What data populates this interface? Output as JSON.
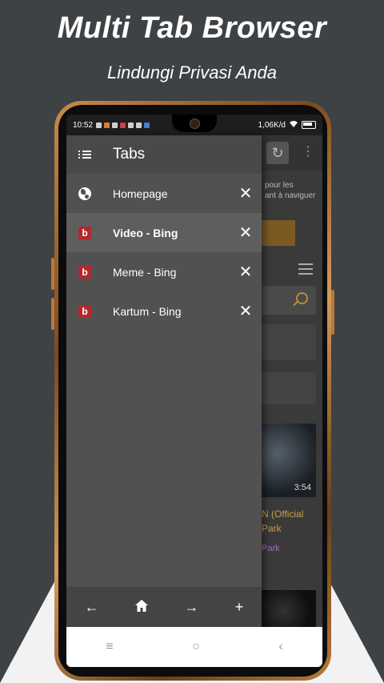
{
  "promo": {
    "headline": "Multi Tab Browser",
    "subline": "Lindungi Privasi Anda"
  },
  "status_bar": {
    "time": "10:52",
    "network_speed": "1,06K/d",
    "battery_icon": "battery-icon"
  },
  "drawer": {
    "title": "Tabs",
    "menu_icon": "list-icon",
    "tabs": [
      {
        "label": "Homepage",
        "icon": "globe-icon",
        "active": false,
        "bold": false
      },
      {
        "label": "Video - Bing",
        "icon": "bing-icon",
        "active": true,
        "bold": true
      },
      {
        "label": "Meme - Bing",
        "icon": "bing-icon",
        "active": false,
        "bold": false
      },
      {
        "label": "Kartum - Bing",
        "icon": "bing-icon",
        "active": false,
        "bold": false
      }
    ],
    "close_glyph": "✕",
    "bing_letter": "b",
    "bottom_bar": {
      "back": "←",
      "home": "⌂",
      "forward": "→",
      "add": "+"
    }
  },
  "page_behind": {
    "cookie_line1": "pour les",
    "cookie_line2": "ant à naviguer",
    "video_duration": "3:54",
    "video_title_line1": "N (Official",
    "video_title_line2": "Park",
    "video_channel": "Park"
  },
  "system_nav": {
    "recent": "≡",
    "home": "○",
    "back": "‹"
  },
  "colors": {
    "background": "#3f4244",
    "drawer": "#515151",
    "active_tab": "#5e5e5e",
    "bing_red": "#b3282e",
    "accent_gold": "#c08a3b"
  }
}
